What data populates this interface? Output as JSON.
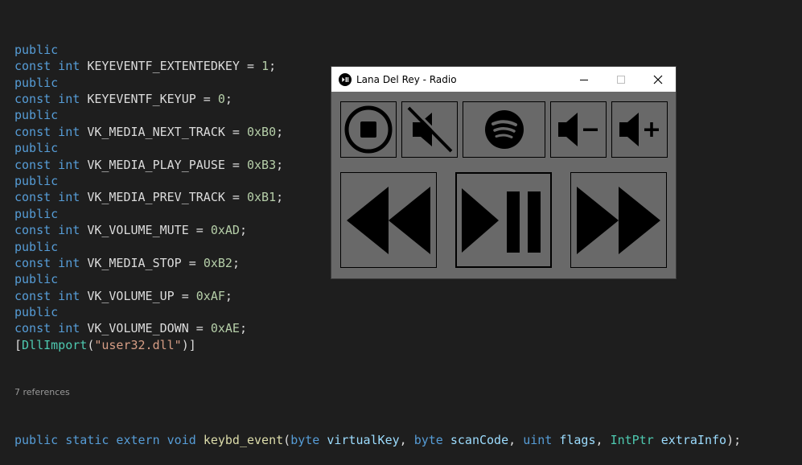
{
  "code": {
    "lines": [
      [
        {
          "t": "public",
          "c": "kw"
        }
      ],
      [
        {
          "t": "const int ",
          "c": "kw"
        },
        {
          "t": "KEYEVENTF_EXTENTEDKEY",
          "c": "id"
        },
        {
          "t": " = ",
          "c": "punct"
        },
        {
          "t": "1",
          "c": "num"
        },
        {
          "t": ";",
          "c": "punct"
        }
      ],
      [
        {
          "t": "public",
          "c": "kw"
        }
      ],
      [
        {
          "t": "const int ",
          "c": "kw"
        },
        {
          "t": "KEYEVENTF_KEYUP",
          "c": "id"
        },
        {
          "t": " = ",
          "c": "punct"
        },
        {
          "t": "0",
          "c": "num"
        },
        {
          "t": ";",
          "c": "punct"
        }
      ],
      [
        {
          "t": "public",
          "c": "kw"
        }
      ],
      [
        {
          "t": "const int ",
          "c": "kw"
        },
        {
          "t": "VK_MEDIA_NEXT_TRACK",
          "c": "id"
        },
        {
          "t": " = ",
          "c": "punct"
        },
        {
          "t": "0xB0",
          "c": "num"
        },
        {
          "t": ";",
          "c": "punct"
        }
      ],
      [
        {
          "t": "public",
          "c": "kw"
        }
      ],
      [
        {
          "t": "const int ",
          "c": "kw"
        },
        {
          "t": "VK_MEDIA_PLAY_PAUSE",
          "c": "id"
        },
        {
          "t": " = ",
          "c": "punct"
        },
        {
          "t": "0xB3",
          "c": "num"
        },
        {
          "t": ";",
          "c": "punct"
        }
      ],
      [
        {
          "t": "public",
          "c": "kw"
        }
      ],
      [
        {
          "t": "const int ",
          "c": "kw"
        },
        {
          "t": "VK_MEDIA_PREV_TRACK",
          "c": "id"
        },
        {
          "t": " = ",
          "c": "punct"
        },
        {
          "t": "0xB1",
          "c": "num"
        },
        {
          "t": ";",
          "c": "punct"
        }
      ],
      [
        {
          "t": "public",
          "c": "kw"
        }
      ],
      [
        {
          "t": "const int ",
          "c": "kw"
        },
        {
          "t": "VK_VOLUME_MUTE",
          "c": "id"
        },
        {
          "t": " = ",
          "c": "punct"
        },
        {
          "t": "0xAD",
          "c": "num"
        },
        {
          "t": ";",
          "c": "punct"
        }
      ],
      [
        {
          "t": "public",
          "c": "kw"
        }
      ],
      [
        {
          "t": "const int ",
          "c": "kw"
        },
        {
          "t": "VK_MEDIA_STOP",
          "c": "id"
        },
        {
          "t": " = ",
          "c": "punct"
        },
        {
          "t": "0xB2",
          "c": "num"
        },
        {
          "t": ";",
          "c": "punct"
        }
      ],
      [
        {
          "t": "public",
          "c": "kw"
        }
      ],
      [
        {
          "t": "const int ",
          "c": "kw"
        },
        {
          "t": "VK_VOLUME_UP",
          "c": "id"
        },
        {
          "t": " = ",
          "c": "punct"
        },
        {
          "t": "0xAF",
          "c": "num"
        },
        {
          "t": ";",
          "c": "punct"
        }
      ],
      [
        {
          "t": "public",
          "c": "kw"
        }
      ],
      [
        {
          "t": "const int ",
          "c": "kw"
        },
        {
          "t": "VK_VOLUME_DOWN",
          "c": "id"
        },
        {
          "t": " = ",
          "c": "punct"
        },
        {
          "t": "0xAE",
          "c": "num"
        },
        {
          "t": ";",
          "c": "punct"
        }
      ],
      [
        {
          "t": "[",
          "c": "punct"
        },
        {
          "t": "DllImport",
          "c": "type"
        },
        {
          "t": "(",
          "c": "punct"
        },
        {
          "t": "\"user32.dll\"",
          "c": "str"
        },
        {
          "t": ")]",
          "c": "punct"
        }
      ]
    ],
    "codelens": "7 references",
    "signature": [
      {
        "t": "public static extern void ",
        "c": "kw"
      },
      {
        "t": "keybd_event",
        "c": "fn"
      },
      {
        "t": "(",
        "c": "punct"
      },
      {
        "t": "byte ",
        "c": "kw"
      },
      {
        "t": "virtualKey",
        "c": "param"
      },
      {
        "t": ", ",
        "c": "punct"
      },
      {
        "t": "byte ",
        "c": "kw"
      },
      {
        "t": "scanCode",
        "c": "param"
      },
      {
        "t": ", ",
        "c": "punct"
      },
      {
        "t": "uint ",
        "c": "kw"
      },
      {
        "t": "flags",
        "c": "param"
      },
      {
        "t": ", ",
        "c": "punct"
      },
      {
        "t": "IntPtr ",
        "c": "type"
      },
      {
        "t": "extraInfo",
        "c": "param"
      },
      {
        "t": ");",
        "c": "punct"
      }
    ]
  },
  "window": {
    "title": "Lana Del Rey - Radio",
    "controls": {
      "minimize": "minimize-icon",
      "maximize": "maximize-icon",
      "close": "close-icon"
    },
    "top_buttons": [
      "stop-icon",
      "mute-icon",
      "spotify-icon",
      "volume-down-icon",
      "volume-up-icon"
    ],
    "bottom_buttons": [
      "previous-track-icon",
      "play-pause-icon",
      "next-track-icon"
    ],
    "focused_button": "play-pause-icon"
  },
  "colors": {
    "editor_background": "#1e1e1e",
    "keyword": "#569cd6",
    "identifier": "#dcdcdc",
    "number": "#b5cea8",
    "string": "#d69d85",
    "type": "#4ec9b0",
    "method": "#dcdcaa",
    "parameter": "#9cdcfe",
    "window_body": "#696969",
    "titlebar": "#ffffff"
  }
}
